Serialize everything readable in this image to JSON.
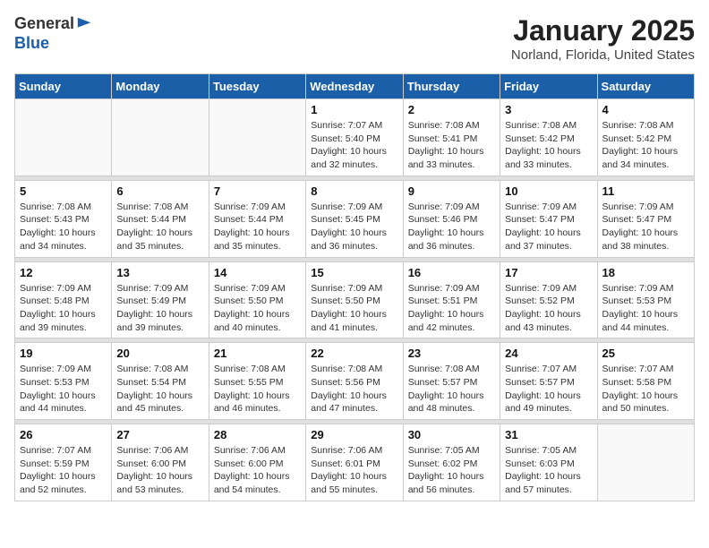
{
  "logo": {
    "general": "General",
    "blue": "Blue"
  },
  "header": {
    "title": "January 2025",
    "subtitle": "Norland, Florida, United States"
  },
  "weekdays": [
    "Sunday",
    "Monday",
    "Tuesday",
    "Wednesday",
    "Thursday",
    "Friday",
    "Saturday"
  ],
  "weeks": [
    [
      {
        "day": "",
        "info": ""
      },
      {
        "day": "",
        "info": ""
      },
      {
        "day": "",
        "info": ""
      },
      {
        "day": "1",
        "info": "Sunrise: 7:07 AM\nSunset: 5:40 PM\nDaylight: 10 hours\nand 32 minutes."
      },
      {
        "day": "2",
        "info": "Sunrise: 7:08 AM\nSunset: 5:41 PM\nDaylight: 10 hours\nand 33 minutes."
      },
      {
        "day": "3",
        "info": "Sunrise: 7:08 AM\nSunset: 5:42 PM\nDaylight: 10 hours\nand 33 minutes."
      },
      {
        "day": "4",
        "info": "Sunrise: 7:08 AM\nSunset: 5:42 PM\nDaylight: 10 hours\nand 34 minutes."
      }
    ],
    [
      {
        "day": "5",
        "info": "Sunrise: 7:08 AM\nSunset: 5:43 PM\nDaylight: 10 hours\nand 34 minutes."
      },
      {
        "day": "6",
        "info": "Sunrise: 7:08 AM\nSunset: 5:44 PM\nDaylight: 10 hours\nand 35 minutes."
      },
      {
        "day": "7",
        "info": "Sunrise: 7:09 AM\nSunset: 5:44 PM\nDaylight: 10 hours\nand 35 minutes."
      },
      {
        "day": "8",
        "info": "Sunrise: 7:09 AM\nSunset: 5:45 PM\nDaylight: 10 hours\nand 36 minutes."
      },
      {
        "day": "9",
        "info": "Sunrise: 7:09 AM\nSunset: 5:46 PM\nDaylight: 10 hours\nand 36 minutes."
      },
      {
        "day": "10",
        "info": "Sunrise: 7:09 AM\nSunset: 5:47 PM\nDaylight: 10 hours\nand 37 minutes."
      },
      {
        "day": "11",
        "info": "Sunrise: 7:09 AM\nSunset: 5:47 PM\nDaylight: 10 hours\nand 38 minutes."
      }
    ],
    [
      {
        "day": "12",
        "info": "Sunrise: 7:09 AM\nSunset: 5:48 PM\nDaylight: 10 hours\nand 39 minutes."
      },
      {
        "day": "13",
        "info": "Sunrise: 7:09 AM\nSunset: 5:49 PM\nDaylight: 10 hours\nand 39 minutes."
      },
      {
        "day": "14",
        "info": "Sunrise: 7:09 AM\nSunset: 5:50 PM\nDaylight: 10 hours\nand 40 minutes."
      },
      {
        "day": "15",
        "info": "Sunrise: 7:09 AM\nSunset: 5:50 PM\nDaylight: 10 hours\nand 41 minutes."
      },
      {
        "day": "16",
        "info": "Sunrise: 7:09 AM\nSunset: 5:51 PM\nDaylight: 10 hours\nand 42 minutes."
      },
      {
        "day": "17",
        "info": "Sunrise: 7:09 AM\nSunset: 5:52 PM\nDaylight: 10 hours\nand 43 minutes."
      },
      {
        "day": "18",
        "info": "Sunrise: 7:09 AM\nSunset: 5:53 PM\nDaylight: 10 hours\nand 44 minutes."
      }
    ],
    [
      {
        "day": "19",
        "info": "Sunrise: 7:09 AM\nSunset: 5:53 PM\nDaylight: 10 hours\nand 44 minutes."
      },
      {
        "day": "20",
        "info": "Sunrise: 7:08 AM\nSunset: 5:54 PM\nDaylight: 10 hours\nand 45 minutes."
      },
      {
        "day": "21",
        "info": "Sunrise: 7:08 AM\nSunset: 5:55 PM\nDaylight: 10 hours\nand 46 minutes."
      },
      {
        "day": "22",
        "info": "Sunrise: 7:08 AM\nSunset: 5:56 PM\nDaylight: 10 hours\nand 47 minutes."
      },
      {
        "day": "23",
        "info": "Sunrise: 7:08 AM\nSunset: 5:57 PM\nDaylight: 10 hours\nand 48 minutes."
      },
      {
        "day": "24",
        "info": "Sunrise: 7:07 AM\nSunset: 5:57 PM\nDaylight: 10 hours\nand 49 minutes."
      },
      {
        "day": "25",
        "info": "Sunrise: 7:07 AM\nSunset: 5:58 PM\nDaylight: 10 hours\nand 50 minutes."
      }
    ],
    [
      {
        "day": "26",
        "info": "Sunrise: 7:07 AM\nSunset: 5:59 PM\nDaylight: 10 hours\nand 52 minutes."
      },
      {
        "day": "27",
        "info": "Sunrise: 7:06 AM\nSunset: 6:00 PM\nDaylight: 10 hours\nand 53 minutes."
      },
      {
        "day": "28",
        "info": "Sunrise: 7:06 AM\nSunset: 6:00 PM\nDaylight: 10 hours\nand 54 minutes."
      },
      {
        "day": "29",
        "info": "Sunrise: 7:06 AM\nSunset: 6:01 PM\nDaylight: 10 hours\nand 55 minutes."
      },
      {
        "day": "30",
        "info": "Sunrise: 7:05 AM\nSunset: 6:02 PM\nDaylight: 10 hours\nand 56 minutes."
      },
      {
        "day": "31",
        "info": "Sunrise: 7:05 AM\nSunset: 6:03 PM\nDaylight: 10 hours\nand 57 minutes."
      },
      {
        "day": "",
        "info": ""
      }
    ]
  ]
}
